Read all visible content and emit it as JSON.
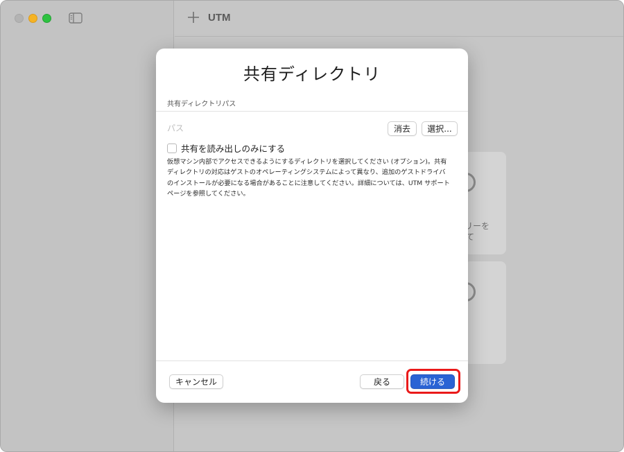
{
  "app": {
    "title": "UTM",
    "toolbar_icons": [
      "sidebar-toggle-icon",
      "plus-icon"
    ],
    "background_fragments": [
      "リーを",
      "て",
      "、"
    ]
  },
  "dialog": {
    "title": "共有ディレクトリ",
    "section_label": "共有ディレクトリパス",
    "path": {
      "value": "",
      "placeholder": "パス"
    },
    "clear_label": "消去",
    "select_label": "選択...",
    "readonly_checkbox": {
      "label": "共有を読み出しのみにする",
      "checked": false
    },
    "description_lines": [
      "仮想マシン内部でアクセスできるようにするディレクトリを選択してください (オプション)。共有",
      "ディレクトリの対応はゲストのオペレーティングシステムによって異なり、追加のゲストドライバ",
      "のインストールが必要になる場合があることに注意してください。詳細については、UTM サポート",
      "ページを参照してください。"
    ],
    "cancel_label": "キャンセル",
    "back_label": "戻る",
    "continue_label": "続ける"
  },
  "colors": {
    "accent": "#2a63d4",
    "highlight": "#ea1a1a",
    "traffic_close": "#b3b3b3",
    "traffic_minimize": "#f5b324",
    "traffic_maximize": "#2dc240"
  }
}
